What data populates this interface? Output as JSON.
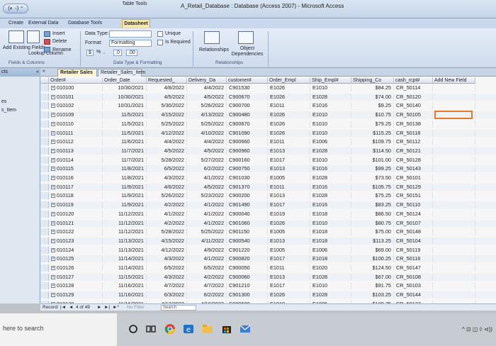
{
  "titlebar": {
    "quick_access": "(◐ -) ⁼",
    "context_group": "Table Tools",
    "window_title": "A_Retail_Database : Database (Access 2007) - Microsoft Access"
  },
  "ribbon_tabs": {
    "create": "Create",
    "external": "External Data",
    "dbtools": "Database Tools",
    "datasheet": "Datasheet"
  },
  "ribbon": {
    "add_existing_fields": "Add Existing Fields",
    "lookup_column": "Lookup Column",
    "insert": "Insert",
    "delete": "Delete",
    "rename": "Rename",
    "fields_columns_label": "Fields & Columns",
    "data_type": "Data Type:",
    "format": "Format:",
    "format_value": "Formatting",
    "currency": "$",
    "percent": "%",
    "comma": ",",
    "dec_inc": ".0",
    "dec_dec": ".00",
    "datatype_label": "Data Type & Formatting",
    "unique": "Unique",
    "is_required": "Is Required",
    "relationships": "Relationships",
    "object_dependencies": "Object Dependencies",
    "relationships_label": "Relationships"
  },
  "nav_pane": {
    "header": "cts",
    "collapse": "«",
    "items": [
      "es",
      "s_Item"
    ]
  },
  "doc_tabs": [
    "Retailer Sales",
    "Retailer_Sales_Item"
  ],
  "columns": [
    "Order#",
    "Order_Date",
    "Requested_",
    "Delivery_Da",
    "customer#",
    "Order_Empl",
    "Ship_Empl#",
    "Shipping_Co",
    "cash_rcpt#",
    "Add New Field"
  ],
  "rows": [
    [
      "010100",
      "10/30/2021",
      "4/8/2022",
      "4/4/2022",
      "C901530",
      "E1026",
      "E1010",
      "$84.25",
      "CR_50114"
    ],
    [
      "010101",
      "10/30/2021",
      "4/5/2022",
      "4/5/2022",
      "C900670",
      "E1026",
      "E1028",
      "$74.00",
      "CR_50120"
    ],
    [
      "010102",
      "10/31/2021",
      "5/30/2022",
      "5/26/2022",
      "C900700",
      "E1011",
      "E1016",
      "$9.25",
      "CR_50140"
    ],
    [
      "010109",
      "11/5/2021",
      "4/15/2022",
      "4/13/2022",
      "C900480",
      "E1026",
      "E1010",
      "$10.75",
      "CR_50105"
    ],
    [
      "010110",
      "11/5/2021",
      "5/25/2022",
      "5/25/2022",
      "C900670",
      "E1026",
      "E1010",
      "$79.25",
      "CR_50138"
    ],
    [
      "010111",
      "11/5/2021",
      "4/12/2022",
      "4/10/2022",
      "C901090",
      "E1026",
      "E1010",
      "$115.25",
      "CR_50118"
    ],
    [
      "010112",
      "11/6/2021",
      "4/4/2022",
      "4/4/2022",
      "C900660",
      "E1011",
      "E1006",
      "$109.75",
      "CR_50112"
    ],
    [
      "010113",
      "11/7/2021",
      "4/5/2022",
      "4/5/2022",
      "C900960",
      "E1013",
      "E1028",
      "$114.50",
      "CR_50121"
    ],
    [
      "010114",
      "11/7/2021",
      "5/28/2022",
      "5/27/2022",
      "C900160",
      "E1017",
      "E1010",
      "$101.00",
      "CR_50128"
    ],
    [
      "010115",
      "11/8/2021",
      "6/5/2022",
      "6/2/2022",
      "C900750",
      "E1013",
      "E1016",
      "$99.25",
      "CR_50143"
    ],
    [
      "010116",
      "11/8/2021",
      "4/3/2022",
      "4/1/2022",
      "C901030",
      "E1005",
      "E1028",
      "$73.50",
      "CR_50101"
    ],
    [
      "010117",
      "11/9/2021",
      "4/6/2022",
      "4/5/2022",
      "C901370",
      "E1011",
      "E1016",
      "$105.75",
      "CR_50129"
    ],
    [
      "010118",
      "11/9/2021",
      "5/26/2022",
      "5/23/2022",
      "C900200",
      "E1013",
      "E1028",
      "$75.25",
      "CR_50151"
    ],
    [
      "010119",
      "11/9/2021",
      "4/2/2022",
      "4/1/2022",
      "C901490",
      "E1017",
      "E1016",
      "$83.25",
      "CR_50110"
    ],
    [
      "010120",
      "11/12/2021",
      "4/1/2022",
      "4/1/2022",
      "C900040",
      "E1019",
      "E1018",
      "$86.50",
      "CR_50124"
    ],
    [
      "010121",
      "11/12/2021",
      "4/2/2022",
      "4/1/2022",
      "C901060",
      "E1026",
      "E1010",
      "$80.75",
      "CR_50107"
    ],
    [
      "010122",
      "11/12/2021",
      "5/28/2022",
      "5/25/2022",
      "C901150",
      "E1005",
      "E1018",
      "$75.00",
      "CR_50148"
    ],
    [
      "010123",
      "11/13/2021",
      "4/15/2022",
      "4/11/2022",
      "C900540",
      "E1013",
      "E1018",
      "$113.25",
      "CR_50104"
    ],
    [
      "010124",
      "11/13/2021",
      "4/12/2022",
      "4/9/2022",
      "C901220",
      "E1005",
      "E1006",
      "$69.00",
      "CR_50119"
    ],
    [
      "010125",
      "11/14/2021",
      "4/3/2022",
      "4/1/2022",
      "C900820",
      "E1017",
      "E1018",
      "$100.25",
      "CR_50116"
    ],
    [
      "010126",
      "11/14/2021",
      "6/5/2022",
      "6/5/2022",
      "C900050",
      "E1011",
      "E1020",
      "$124.50",
      "CR_50147"
    ],
    [
      "010127",
      "11/15/2021",
      "4/3/2022",
      "4/2/2022",
      "C900060",
      "E1013",
      "E1028",
      "$67.00",
      "CR_50108"
    ],
    [
      "010128",
      "11/16/2021",
      "4/7/2022",
      "4/7/2022",
      "C901210",
      "E1017",
      "E1010",
      "$91.75",
      "CR_50103"
    ],
    [
      "010129",
      "11/16/2021",
      "6/3/2022",
      "6/2/2022",
      "C901300",
      "E1026",
      "E1028",
      "$103.25",
      "CR_50144"
    ],
    [
      "010130",
      "11/16/2021",
      "4/12/2022",
      "4/10/2022",
      "C900680",
      "E1019",
      "E1006",
      "$108.75",
      "CR_50123"
    ]
  ],
  "record_nav": {
    "label": "Record:",
    "first": "|◄",
    "prev": "◄",
    "position": "4 of 49",
    "next": "►",
    "last": "►|",
    "new": "►*",
    "filter": "No Filter",
    "search": "Search"
  },
  "taskbar": {
    "search_text": "here to search",
    "tray": "^ ⊡ ◫ ◊ ⊲))"
  }
}
